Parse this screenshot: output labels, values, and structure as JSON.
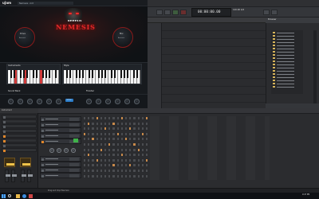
{
  "plugin": {
    "logo": "uJam",
    "preset_name": "Nemesis - Init",
    "brand": "NEMESIS",
    "title": "NEMESIS",
    "knob_left": {
      "label": "Drive",
      "sub": "Amount"
    },
    "knob_right": {
      "label": "Mix",
      "sub": "Amount"
    },
    "sections": {
      "instruments": "Instruments",
      "style": "Style",
      "finisher": "Finisher",
      "sound_bank": "Sound Bank"
    },
    "tab_button": "STYLE"
  },
  "daw": {
    "time": "00:00:00.00",
    "bpm": "120.00  4/4",
    "browser_title": "Browser",
    "folders_count": 18,
    "status_text": "Drag and drop files here"
  },
  "instrument_panel": {
    "title": "Instrument"
  },
  "taskbar": {
    "time": "9:47 PM",
    "date": "1/11/2021"
  },
  "icons": [
    "windows-start-icon",
    "search-icon",
    "explorer-icon",
    "browser-icon",
    "daw-icon"
  ],
  "colors": {
    "accent_red": "#e02a2a",
    "step_on": "#c98a4a",
    "folder": "#d6b45a",
    "tab_blue": "#2a7cc8"
  }
}
